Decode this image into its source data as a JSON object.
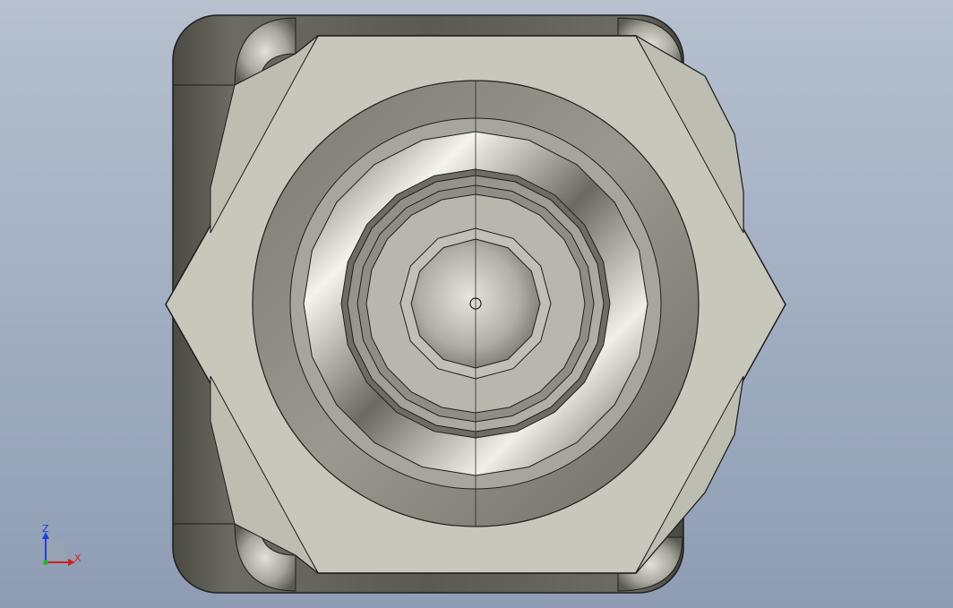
{
  "viewport": {
    "background_top": "#b6c0cf",
    "background_bottom": "#8e9db4"
  },
  "part": {
    "body_color": "#5e5e55",
    "hex_face_color": "#c8c7bc",
    "collar_color": "#8f8e85",
    "ring_color": "#a9a89f",
    "cap_color": "#b4b3ab",
    "edge_color": "#1e1e1e"
  },
  "triad": {
    "z_label": "Z",
    "x_label": "X",
    "z_color": "#1f3fd6",
    "x_color": "#d61f1f",
    "y_color": "#2bb32b"
  }
}
